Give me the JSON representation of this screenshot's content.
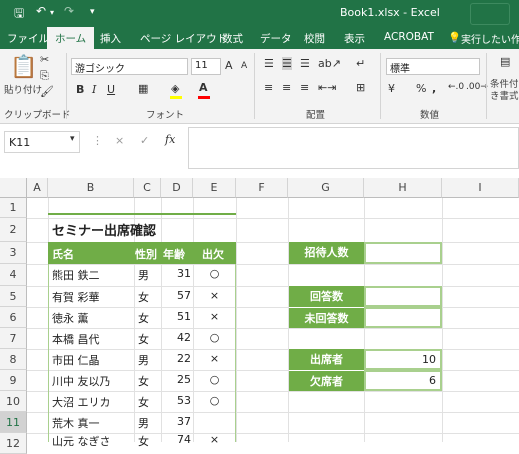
{
  "titlebar": {
    "title": "Book1.xlsx  -  Excel",
    "save_icon": "save-icon",
    "undo_icon": "undo-icon",
    "redo_icon": "redo-icon"
  },
  "tabs": [
    {
      "label": "ファイル"
    },
    {
      "label": "ホーム"
    },
    {
      "label": "挿入"
    },
    {
      "label": "ページ レイアウト"
    },
    {
      "label": "数式"
    },
    {
      "label": "データ"
    },
    {
      "label": "校閲"
    },
    {
      "label": "表示"
    },
    {
      "label": "ACROBAT"
    },
    {
      "label": "実行したい作業"
    }
  ],
  "ribbon": {
    "paste_label": "貼り付け",
    "clipboard_group": "クリップボード",
    "font_name": "游ゴシック",
    "font_size": "11",
    "font_group": "フォント",
    "align_group": "配置",
    "number_format": "標準",
    "number_group": "数値",
    "conditional_label": "条件付き書式",
    "bold": "B",
    "italic": "I",
    "underline": "U",
    "grow": "A",
    "shrink": "A",
    "percent": "%",
    "comma": ","
  },
  "formula_bar": {
    "name_box": "K11",
    "cancel": "×",
    "enter": "✓",
    "fx": "fx",
    "formula": ""
  },
  "columns": [
    "A",
    "B",
    "C",
    "D",
    "E",
    "F",
    "G",
    "H",
    "I"
  ],
  "rows": [
    "1",
    "2",
    "3",
    "4",
    "5",
    "6",
    "7",
    "8",
    "9",
    "10",
    "11",
    "12"
  ],
  "sheet": {
    "title": "セミナー出席確認",
    "headers": [
      "氏名",
      "性別",
      "年齢",
      "出欠"
    ],
    "records": [
      [
        "熊田 鉄二",
        "男",
        "31",
        "○"
      ],
      [
        "有賀 彩華",
        "女",
        "57",
        "×"
      ],
      [
        "徳永 薫",
        "女",
        "51",
        "×"
      ],
      [
        "本橋 昌代",
        "女",
        "42",
        "○"
      ],
      [
        "市田 仁晶",
        "男",
        "22",
        "×"
      ],
      [
        "川中 友以乃",
        "女",
        "25",
        "○"
      ],
      [
        "大沼 エリカ",
        "女",
        "53",
        "○"
      ],
      [
        "荒木 真一",
        "男",
        "37",
        ""
      ],
      [
        "山元 なぎさ",
        "女",
        "74",
        "×"
      ]
    ],
    "summary": {
      "invited_label": "招待人数",
      "invited_value": "",
      "answered_label": "回答数",
      "answered_value": "",
      "unanswered_label": "未回答数",
      "unanswered_value": "",
      "attend_label": "出席者",
      "attend_value": "10",
      "absent_label": "欠席者",
      "absent_value": "6"
    }
  },
  "colors": {
    "accent": "#217346",
    "table_green": "#70ad47",
    "light_green": "#a9d08e"
  }
}
